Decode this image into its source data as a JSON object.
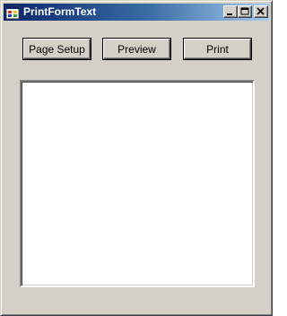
{
  "window": {
    "title": "PrintFormText",
    "caption_buttons": [
      "minimize-icon",
      "maximize-icon",
      "close-icon"
    ]
  },
  "buttons": {
    "page_setup": "Page Setup",
    "preview": "Preview",
    "print": "Print"
  },
  "textbox": {
    "value": ""
  },
  "colors": {
    "face": "#d4d0c8",
    "title_start": "#0a246a",
    "title_end": "#a6caf0"
  }
}
